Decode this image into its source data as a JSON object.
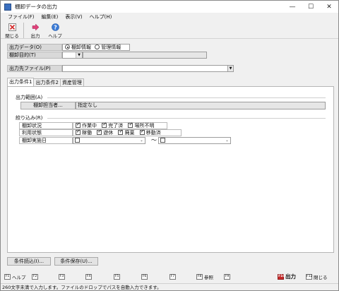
{
  "window": {
    "title": "棚卸データの出力",
    "min": "—",
    "max": "☐",
    "close": "✕"
  },
  "menu": [
    "ファイル(F)",
    "編集(E)",
    "表示(V)",
    "ヘルプ(H)"
  ],
  "toolbar": {
    "close_label": "閉じる",
    "output_label": "出力",
    "help_label": "ヘルプ"
  },
  "output_data": {
    "label": "出力データ(O)",
    "opt1": "棚卸情報",
    "opt2": "管理情報",
    "selected": "棚卸情報"
  },
  "purpose": {
    "label": "棚卸目的(T)",
    "value": ""
  },
  "dest_file": {
    "label": "出力先ファイル(P)",
    "value": ""
  },
  "tabs": [
    "出力条件1",
    "出力条件2",
    "資産管理"
  ],
  "range": {
    "heading": "出力範囲(A)",
    "button": "棚卸担当者...",
    "value": "指定なし"
  },
  "filter": {
    "heading": "絞り込み(R)",
    "rows": [
      {
        "label": "棚卸状況",
        "options": [
          "作業中",
          "完了済",
          "場所不明"
        ]
      },
      {
        "label": "利用状態",
        "options": [
          "稼働",
          "遊休",
          "廃棄",
          "移動済"
        ]
      }
    ],
    "date": {
      "label": "棚卸実施日",
      "sep": "〜"
    }
  },
  "buttons": {
    "load": "条件読込(I)...",
    "save": "条件保存(U)..."
  },
  "fkeys": [
    {
      "key": "F1",
      "label": "ヘルプ"
    },
    {
      "key": "F2",
      "label": ""
    },
    {
      "key": "F3",
      "label": ""
    },
    {
      "key": "F4",
      "label": ""
    },
    {
      "key": "F5",
      "label": ""
    },
    {
      "key": "F6",
      "label": ""
    },
    {
      "key": "F7",
      "label": ""
    },
    {
      "key": "F8",
      "label": "参照"
    },
    {
      "key": "F9",
      "label": ""
    },
    {
      "key": "F10",
      "label": "出力"
    },
    {
      "key": "F12",
      "label": "閉じる"
    }
  ],
  "status": "260文字未満で入力します。ファイルのドロップでパスを自動入力できます。",
  "colors": {
    "accent": "#c62828",
    "header_bg": "#d9d9d9",
    "panel_bg": "#ffffff"
  }
}
